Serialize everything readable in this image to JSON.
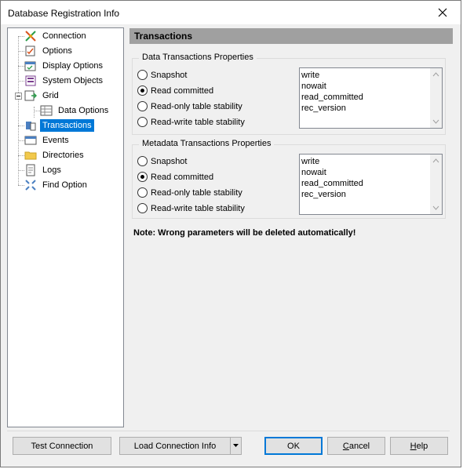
{
  "window": {
    "title": "Database Registration Info"
  },
  "tree": {
    "items": [
      {
        "label": "Connection",
        "icon": "connection-icon"
      },
      {
        "label": "Options",
        "icon": "options-icon"
      },
      {
        "label": "Display Options",
        "icon": "display-options-icon"
      },
      {
        "label": "System Objects",
        "icon": "system-objects-icon"
      },
      {
        "label": "Grid",
        "icon": "grid-icon"
      },
      {
        "label": "Data Options",
        "icon": "data-options-icon"
      },
      {
        "label": "Transactions",
        "icon": "transactions-icon",
        "selected": true
      },
      {
        "label": "Events",
        "icon": "events-icon"
      },
      {
        "label": "Directories",
        "icon": "folder-icon"
      },
      {
        "label": "Logs",
        "icon": "logs-icon"
      },
      {
        "label": "Find Option",
        "icon": "find-option-icon"
      }
    ]
  },
  "header": {
    "title": "Transactions"
  },
  "data_group": {
    "title": "Data Transactions Properties",
    "options": [
      "Snapshot",
      "Read committed",
      "Read-only table stability",
      "Read-write table stability"
    ],
    "selected": "Read committed",
    "params": [
      "write",
      "nowait",
      "read_committed",
      "rec_version"
    ]
  },
  "meta_group": {
    "title": "Metadata Transactions Properties",
    "options": [
      "Snapshot",
      "Read committed",
      "Read-only table stability",
      "Read-write table stability"
    ],
    "selected": "Read committed",
    "params": [
      "write",
      "nowait",
      "read_committed",
      "rec_version"
    ]
  },
  "note": "Note: Wrong parameters will be deleted automatically!",
  "buttons": {
    "test": "Test Connection",
    "load": "Load Connection Info",
    "ok": "OK",
    "cancel_prefix": "C",
    "cancel_rest": "ancel",
    "help_prefix": "H",
    "help_rest": "elp"
  },
  "colors": {
    "selection": "#0078d7",
    "header_bg": "#a0a0a0"
  }
}
